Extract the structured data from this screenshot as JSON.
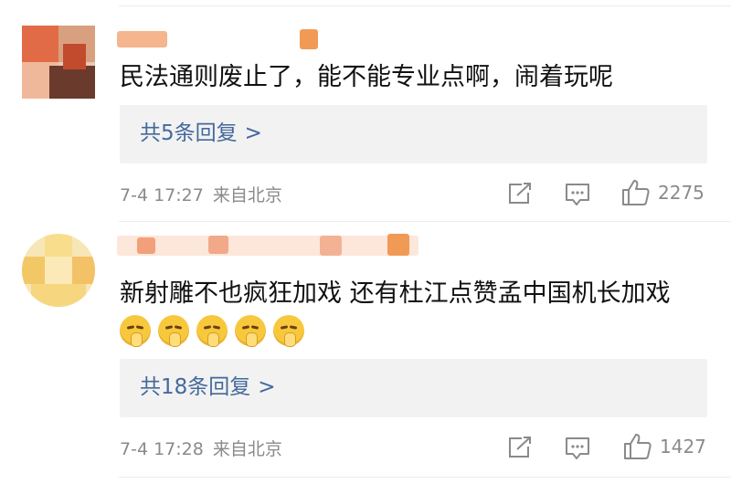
{
  "comments": [
    {
      "text": "民法通则废止了，能不能专业点啊，闹着玩呢",
      "replies_label": "共5条回复",
      "replies_chevron": ">",
      "date": "7-4 17:27",
      "location": "来自北京",
      "likes": "2275",
      "emojis": []
    },
    {
      "text": "新射雕不也疯狂加戏 还有杜江点赞孟中国机长加戏",
      "replies_label": "共18条回复",
      "replies_chevron": ">",
      "date": "7-4 17:28",
      "location": "来自北京",
      "likes": "1427",
      "emojis": [
        "shush-emoji",
        "shush-emoji",
        "shush-emoji",
        "shush-emoji",
        "shush-emoji"
      ]
    }
  ],
  "icons": {
    "share": "share-icon",
    "comment": "comment-icon",
    "like": "thumbs-up-icon"
  },
  "colors": {
    "link": "#44699b",
    "meta": "#8a8a8a",
    "reply_bg": "#f2f2f2"
  }
}
